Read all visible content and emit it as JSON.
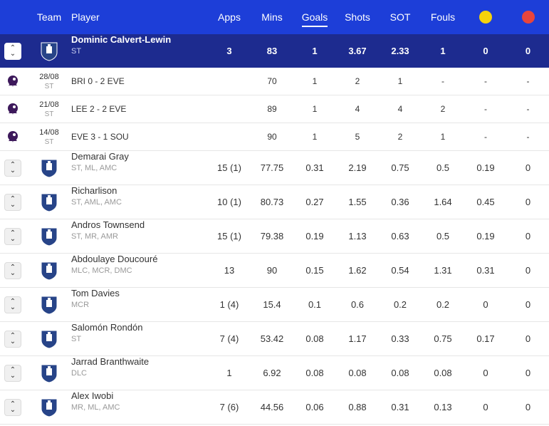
{
  "header": {
    "team": "Team",
    "player": "Player",
    "apps": "Apps",
    "mins": "Mins",
    "goals": "Goals",
    "shots": "Shots",
    "sot": "SOT",
    "fouls": "Fouls",
    "yellow_color": "#f5d20c",
    "red_color": "#e8453c"
  },
  "selected": {
    "name": "Dominic Calvert-Lewin",
    "position": "ST",
    "apps": "3",
    "mins": "83",
    "goals": "1",
    "shots": "3.67",
    "sot": "2.33",
    "fouls": "1",
    "yellow": "0",
    "red": "0",
    "matches": [
      {
        "date": "28/08",
        "pos": "ST",
        "fixture": "BRI  0 - 2  EVE",
        "mins": "70",
        "goals": "1",
        "shots": "2",
        "sot": "1",
        "fouls": "-",
        "yellow": "-",
        "red": "-"
      },
      {
        "date": "21/08",
        "pos": "ST",
        "fixture": "LEE  2 - 2  EVE",
        "mins": "89",
        "goals": "1",
        "shots": "4",
        "sot": "4",
        "fouls": "2",
        "yellow": "-",
        "red": "-"
      },
      {
        "date": "14/08",
        "pos": "ST",
        "fixture": "EVE  3 - 1  SOU",
        "mins": "90",
        "goals": "1",
        "shots": "5",
        "sot": "2",
        "fouls": "1",
        "yellow": "-",
        "red": "-"
      }
    ]
  },
  "players": [
    {
      "name": "Demarai Gray",
      "position": "ST, ML, AMC",
      "apps": "15 (1)",
      "mins": "77.75",
      "goals": "0.31",
      "shots": "2.19",
      "sot": "0.75",
      "fouls": "0.5",
      "yellow": "0.19",
      "red": "0"
    },
    {
      "name": "Richarlison",
      "position": "ST, AML, AMC",
      "apps": "10 (1)",
      "mins": "80.73",
      "goals": "0.27",
      "shots": "1.55",
      "sot": "0.36",
      "fouls": "1.64",
      "yellow": "0.45",
      "red": "0"
    },
    {
      "name": "Andros Townsend",
      "position": "ST, MR, AMR",
      "apps": "15 (1)",
      "mins": "79.38",
      "goals": "0.19",
      "shots": "1.13",
      "sot": "0.63",
      "fouls": "0.5",
      "yellow": "0.19",
      "red": "0"
    },
    {
      "name": "Abdoulaye Doucouré",
      "position": "MLC, MCR, DMC",
      "apps": "13",
      "mins": "90",
      "goals": "0.15",
      "shots": "1.62",
      "sot": "0.54",
      "fouls": "1.31",
      "yellow": "0.31",
      "red": "0"
    },
    {
      "name": "Tom Davies",
      "position": "MCR",
      "apps": "1 (4)",
      "mins": "15.4",
      "goals": "0.1",
      "shots": "0.6",
      "sot": "0.2",
      "fouls": "0.2",
      "yellow": "0",
      "red": "0"
    },
    {
      "name": "Salomón Rondón",
      "position": "ST",
      "apps": "7 (4)",
      "mins": "53.42",
      "goals": "0.08",
      "shots": "1.17",
      "sot": "0.33",
      "fouls": "0.75",
      "yellow": "0.17",
      "red": "0"
    },
    {
      "name": "Jarrad Branthwaite",
      "position": "DLC",
      "apps": "1",
      "mins": "6.92",
      "goals": "0.08",
      "shots": "0.08",
      "sot": "0.08",
      "fouls": "0.08",
      "yellow": "0",
      "red": "0"
    },
    {
      "name": "Alex Iwobi",
      "position": "MR, ML, AMC",
      "apps": "7 (6)",
      "mins": "44.56",
      "goals": "0.06",
      "shots": "0.88",
      "sot": "0.31",
      "fouls": "0.13",
      "yellow": "0",
      "red": "0"
    }
  ],
  "icons": {
    "expand": "expand-collapse-icon",
    "team_crest": "everton-crest-icon",
    "league": "premier-league-lion-icon"
  }
}
